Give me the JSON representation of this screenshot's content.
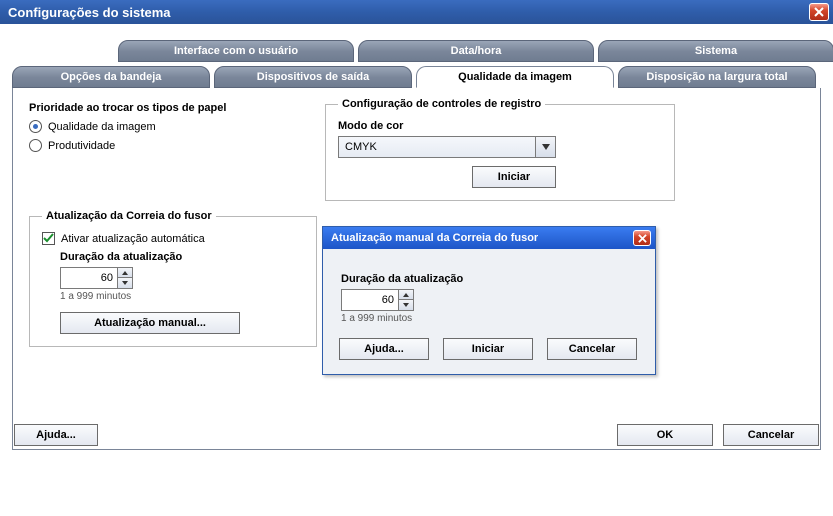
{
  "window": {
    "title": "Configurações do sistema"
  },
  "tabs_row1": [
    {
      "label": "Interface com o usuário"
    },
    {
      "label": "Data/hora"
    },
    {
      "label": "Sistema"
    }
  ],
  "tabs_row2": [
    {
      "label": "Opções da bandeja"
    },
    {
      "label": "Dispositivos de saída"
    },
    {
      "label": "Qualidade da imagem"
    },
    {
      "label": "Disposição na largura total"
    }
  ],
  "priority": {
    "heading": "Prioridade ao trocar os tipos de papel",
    "option1": "Qualidade da imagem",
    "option2": "Produtividade"
  },
  "reg_config": {
    "legend": "Configuração de controles de registro",
    "color_mode_label": "Modo de cor",
    "color_mode_value": "CMYK",
    "start_label": "Iniciar"
  },
  "fuser": {
    "legend": "Atualização da Correia do fusor",
    "checkbox_label": "Ativar atualização automática",
    "duration_label": "Duração da atualização",
    "duration_value": "60",
    "hint": "1 a 999 minutos",
    "manual_label": "Atualização manual..."
  },
  "modal": {
    "title": "Atualização manual da Correia do fusor",
    "duration_label": "Duração da atualização",
    "duration_value": "60",
    "hint": "1 a 999 minutos",
    "help_label": "Ajuda...",
    "start_label": "Iniciar",
    "cancel_label": "Cancelar"
  },
  "footer": {
    "help_label": "Ajuda...",
    "ok_label": "OK",
    "cancel_label": "Cancelar"
  }
}
